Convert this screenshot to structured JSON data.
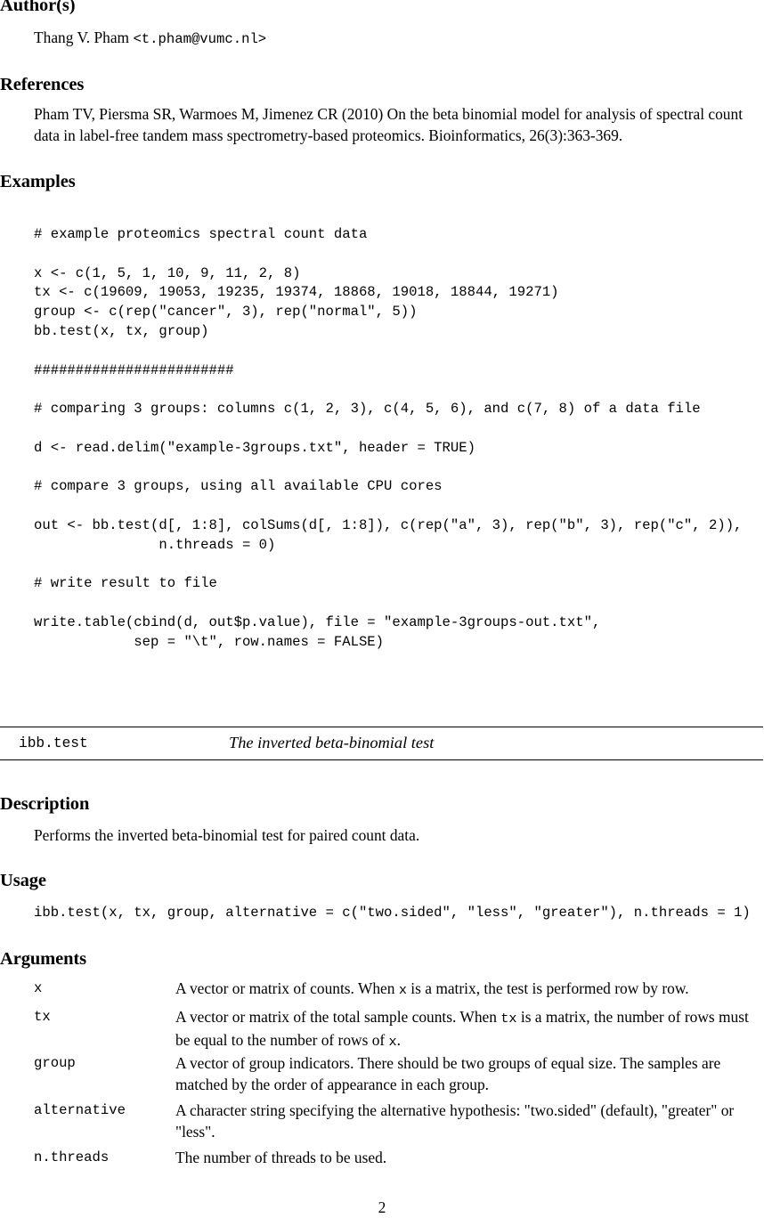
{
  "document": {
    "page_number": "2"
  },
  "sections": {
    "author": {
      "heading": "Author(s)",
      "name": "Thang V. Pham ",
      "email": "<t.pham@vumc.nl>"
    },
    "references": {
      "heading": "References",
      "citation": "Pham TV, Piersma SR, Warmoes M, Jimenez CR (2010) On the beta binomial model for analysis of spectral count data in label-free tandem mass spectrometry-based proteomics. Bioinformatics, 26(3):363-369."
    },
    "examples": {
      "heading": "Examples",
      "code": "# example proteomics spectral count data\n\nx <- c(1, 5, 1, 10, 9, 11, 2, 8)\ntx <- c(19609, 19053, 19235, 19374, 18868, 19018, 18844, 19271)\ngroup <- c(rep(\"cancer\", 3), rep(\"normal\", 5))\nbb.test(x, tx, group)\n\n########################\n\n# comparing 3 groups: columns c(1, 2, 3), c(4, 5, 6), and c(7, 8) of a data file\n\nd <- read.delim(\"example-3groups.txt\", header = TRUE)\n\n# compare 3 groups, using all available CPU cores\n\nout <- bb.test(d[, 1:8], colSums(d[, 1:8]), c(rep(\"a\", 3), rep(\"b\", 3), rep(\"c\", 2)),\n               n.threads = 0)\n\n# write result to file\n\nwrite.table(cbind(d, out$p.value), file = \"example-3groups-out.txt\",\n            sep = \"\\t\", row.names = FALSE)"
    },
    "function_header": {
      "name": "ibb.test",
      "title": "The inverted beta-binomial test"
    },
    "description": {
      "heading": "Description",
      "text": "Performs the inverted beta-binomial test for paired count data."
    },
    "usage": {
      "heading": "Usage",
      "code": "ibb.test(x, tx, group, alternative = c(\"two.sided\", \"less\", \"greater\"), n.threads = 1)"
    },
    "arguments": {
      "heading": "Arguments",
      "items": [
        {
          "term": "x",
          "desc_part1": "A vector or matrix of counts. When ",
          "desc_code1": "x",
          "desc_part2": " is a matrix, the test is performed row by row.",
          "desc_code2": "",
          "desc_part3": ""
        },
        {
          "term": "tx",
          "desc_part1": "A vector or matrix of the total sample counts. When ",
          "desc_code1": "tx",
          "desc_part2": " is a matrix, the number of rows must be equal to the number of rows of ",
          "desc_code2": "x",
          "desc_part3": "."
        },
        {
          "term": "group",
          "desc_part1": "A vector of group indicators. There should be two groups of equal size. The samples are matched by the order of appearance in each group.",
          "desc_code1": "",
          "desc_part2": "",
          "desc_code2": "",
          "desc_part3": ""
        },
        {
          "term": "alternative",
          "desc_part1": "A character string specifying the alternative hypothesis: \"two.sided\" (default), \"greater\" or \"less\".",
          "desc_code1": "",
          "desc_part2": "",
          "desc_code2": "",
          "desc_part3": ""
        },
        {
          "term": "n.threads",
          "desc_part1": "The number of threads to be used.",
          "desc_code1": "",
          "desc_part2": "",
          "desc_code2": "",
          "desc_part3": ""
        }
      ]
    }
  }
}
